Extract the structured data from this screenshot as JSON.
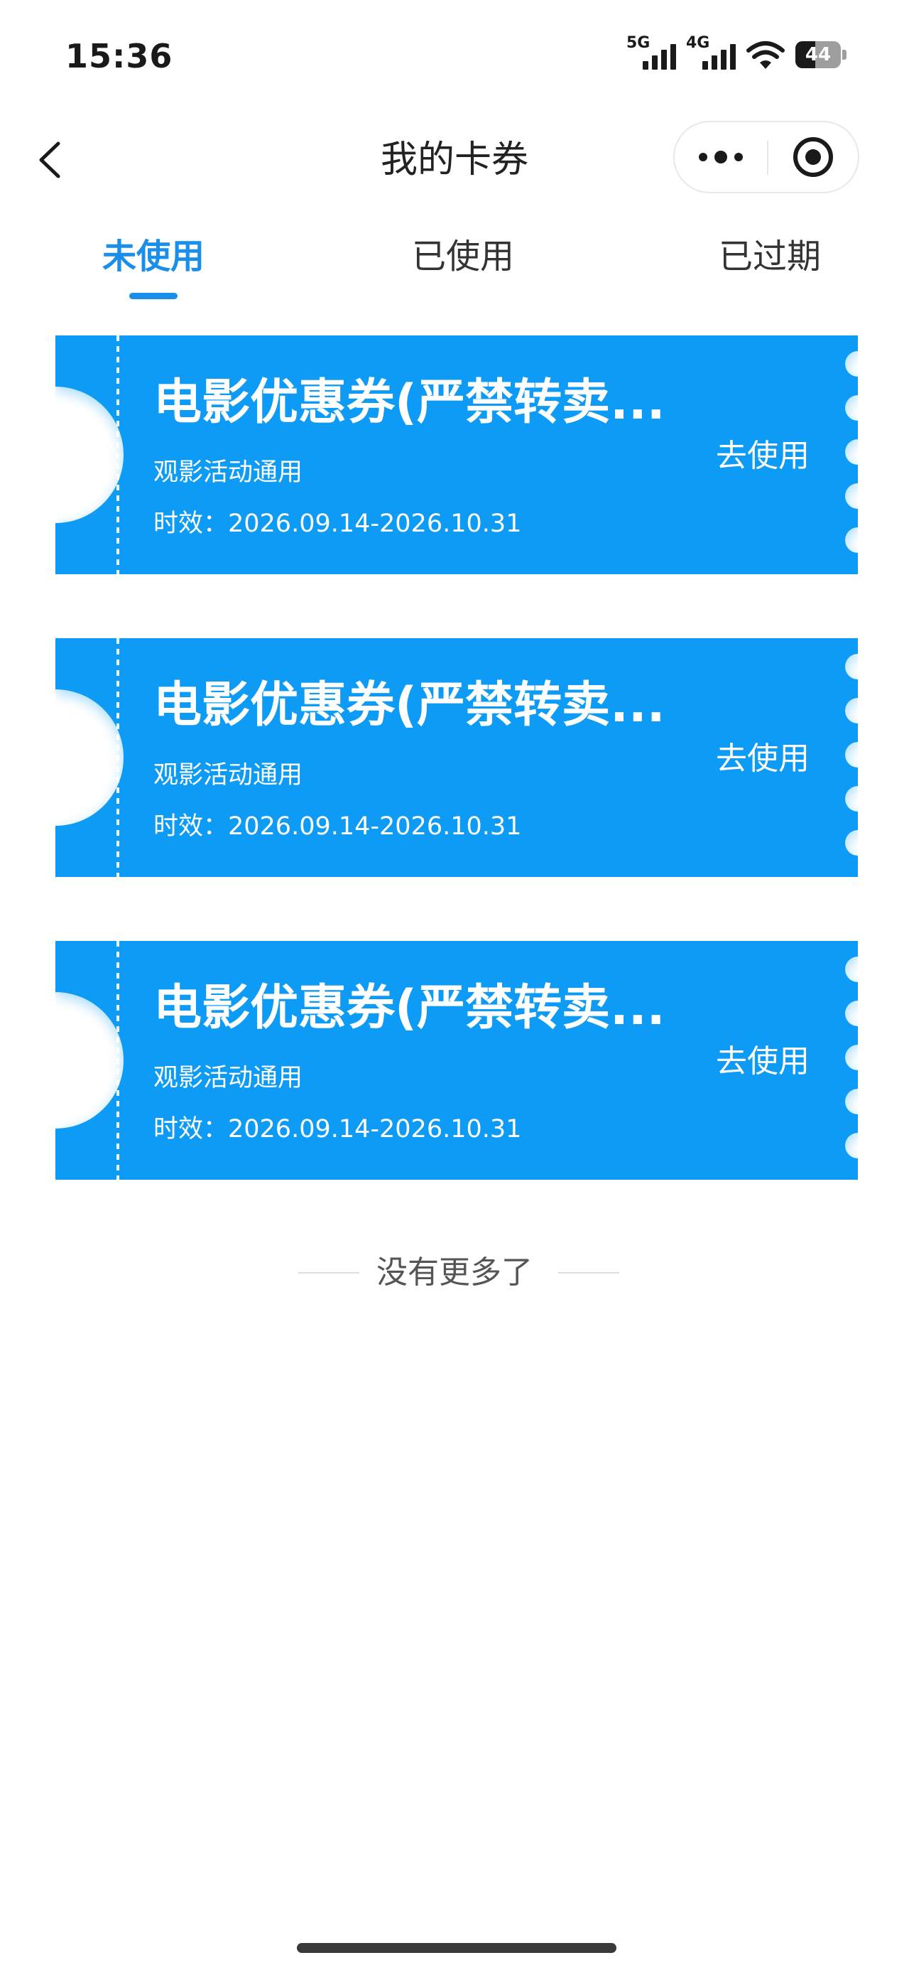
{
  "status_bar": {
    "time": "15:36",
    "network1": "5G",
    "network2": "4G",
    "battery": "44",
    "battery_level": 0.44,
    "icons": [
      "signal-5g-icon",
      "signal-4g-icon",
      "wifi-icon",
      "battery-icon"
    ]
  },
  "nav": {
    "title": "我的卡券",
    "back_icon": "chevron-left-icon",
    "more_icon": "more-dots-icon",
    "close_icon": "target-circle-icon"
  },
  "tabs": [
    {
      "label": "未使用",
      "active": true
    },
    {
      "label": "已使用",
      "active": false
    },
    {
      "label": "已过期",
      "active": false
    }
  ],
  "coupons": [
    {
      "title": "电影优惠券(严禁转卖...",
      "desc": "观影活动通用",
      "validity": "时效：2026.09.14-2026.10.31",
      "action": "去使用"
    },
    {
      "title": "电影优惠券(严禁转卖...",
      "desc": "观影活动通用",
      "validity": "时效：2026.09.14-2026.10.31",
      "action": "去使用"
    },
    {
      "title": "电影优惠券(严禁转卖...",
      "desc": "观影活动通用",
      "validity": "时效：2026.09.14-2026.10.31",
      "action": "去使用"
    }
  ],
  "footer": {
    "end_text": "没有更多了"
  },
  "colors": {
    "accent": "#1a8ee8",
    "coupon": "#0a9bf5",
    "text": "#222222"
  }
}
